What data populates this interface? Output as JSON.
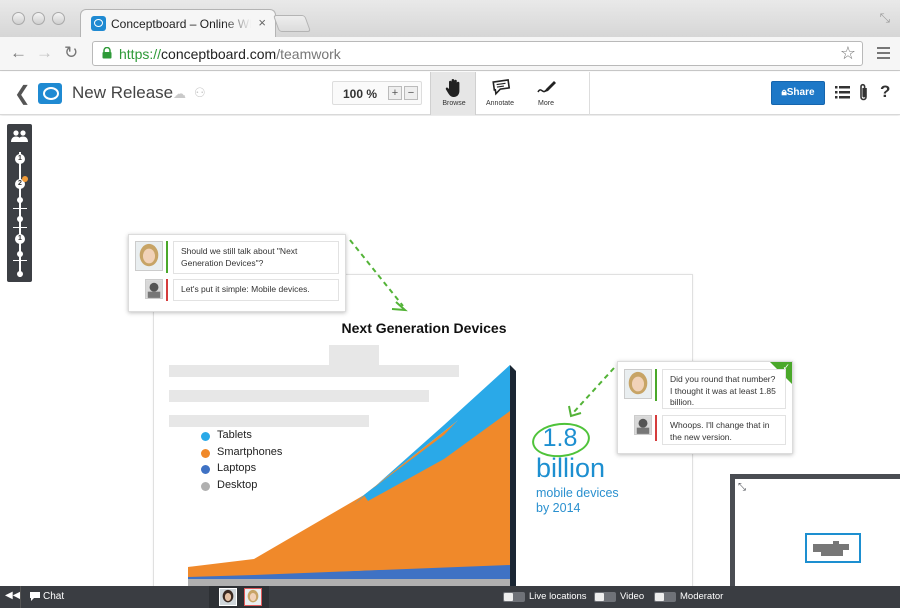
{
  "browser": {
    "tab_title": "Conceptboard – Online Wh",
    "url_scheme": "https://",
    "url_host": "conceptboard.com",
    "url_path": "/teamwork",
    "tab_close": "×"
  },
  "toolbar": {
    "back": "❮",
    "board_title": "New Release",
    "zoom_level": "100 %",
    "zoom_in": "+",
    "zoom_out": "−",
    "tools": [
      {
        "label": "Browse",
        "active": true
      },
      {
        "label": "Annotate",
        "active": false
      },
      {
        "label": "More",
        "active": false
      }
    ],
    "share_label": "Share",
    "help": "?",
    "accent": "#1d78c7"
  },
  "timeline": {
    "nodes": [
      "1",
      "2",
      "1"
    ]
  },
  "slide": {
    "title": "Next Generation Devices",
    "legend": [
      {
        "label": "Tablets",
        "color": "#2aa9e8"
      },
      {
        "label": "Smartphones",
        "color": "#f0892a"
      },
      {
        "label": "Laptops",
        "color": "#3f72c4"
      },
      {
        "label": "Desktop",
        "color": "#b0b0b0"
      }
    ],
    "stat_number": "1.8",
    "stat_unit": "billion",
    "stat_desc_line1": "mobile devices",
    "stat_desc_line2": "by 2014"
  },
  "chart_data": {
    "type": "area",
    "title": "Next Generation Devices",
    "series": [
      {
        "name": "Tablets"
      },
      {
        "name": "Smartphones"
      },
      {
        "name": "Laptops"
      },
      {
        "name": "Desktop"
      }
    ]
  },
  "comments": {
    "thread1": [
      "Should we still talk about \"Next Generation Devices\"?",
      "Let's put it simple: Mobile devices."
    ],
    "thread2": [
      "Did you round that number? I thought it was at least 1.85 billion.",
      "Whoops. I'll change that in the new version."
    ],
    "resolved_color": "#4aa82a"
  },
  "bottombar": {
    "collapse": "◀◀",
    "chat_label": "Chat",
    "toggles": [
      "Live locations",
      "Video",
      "Moderator"
    ]
  }
}
